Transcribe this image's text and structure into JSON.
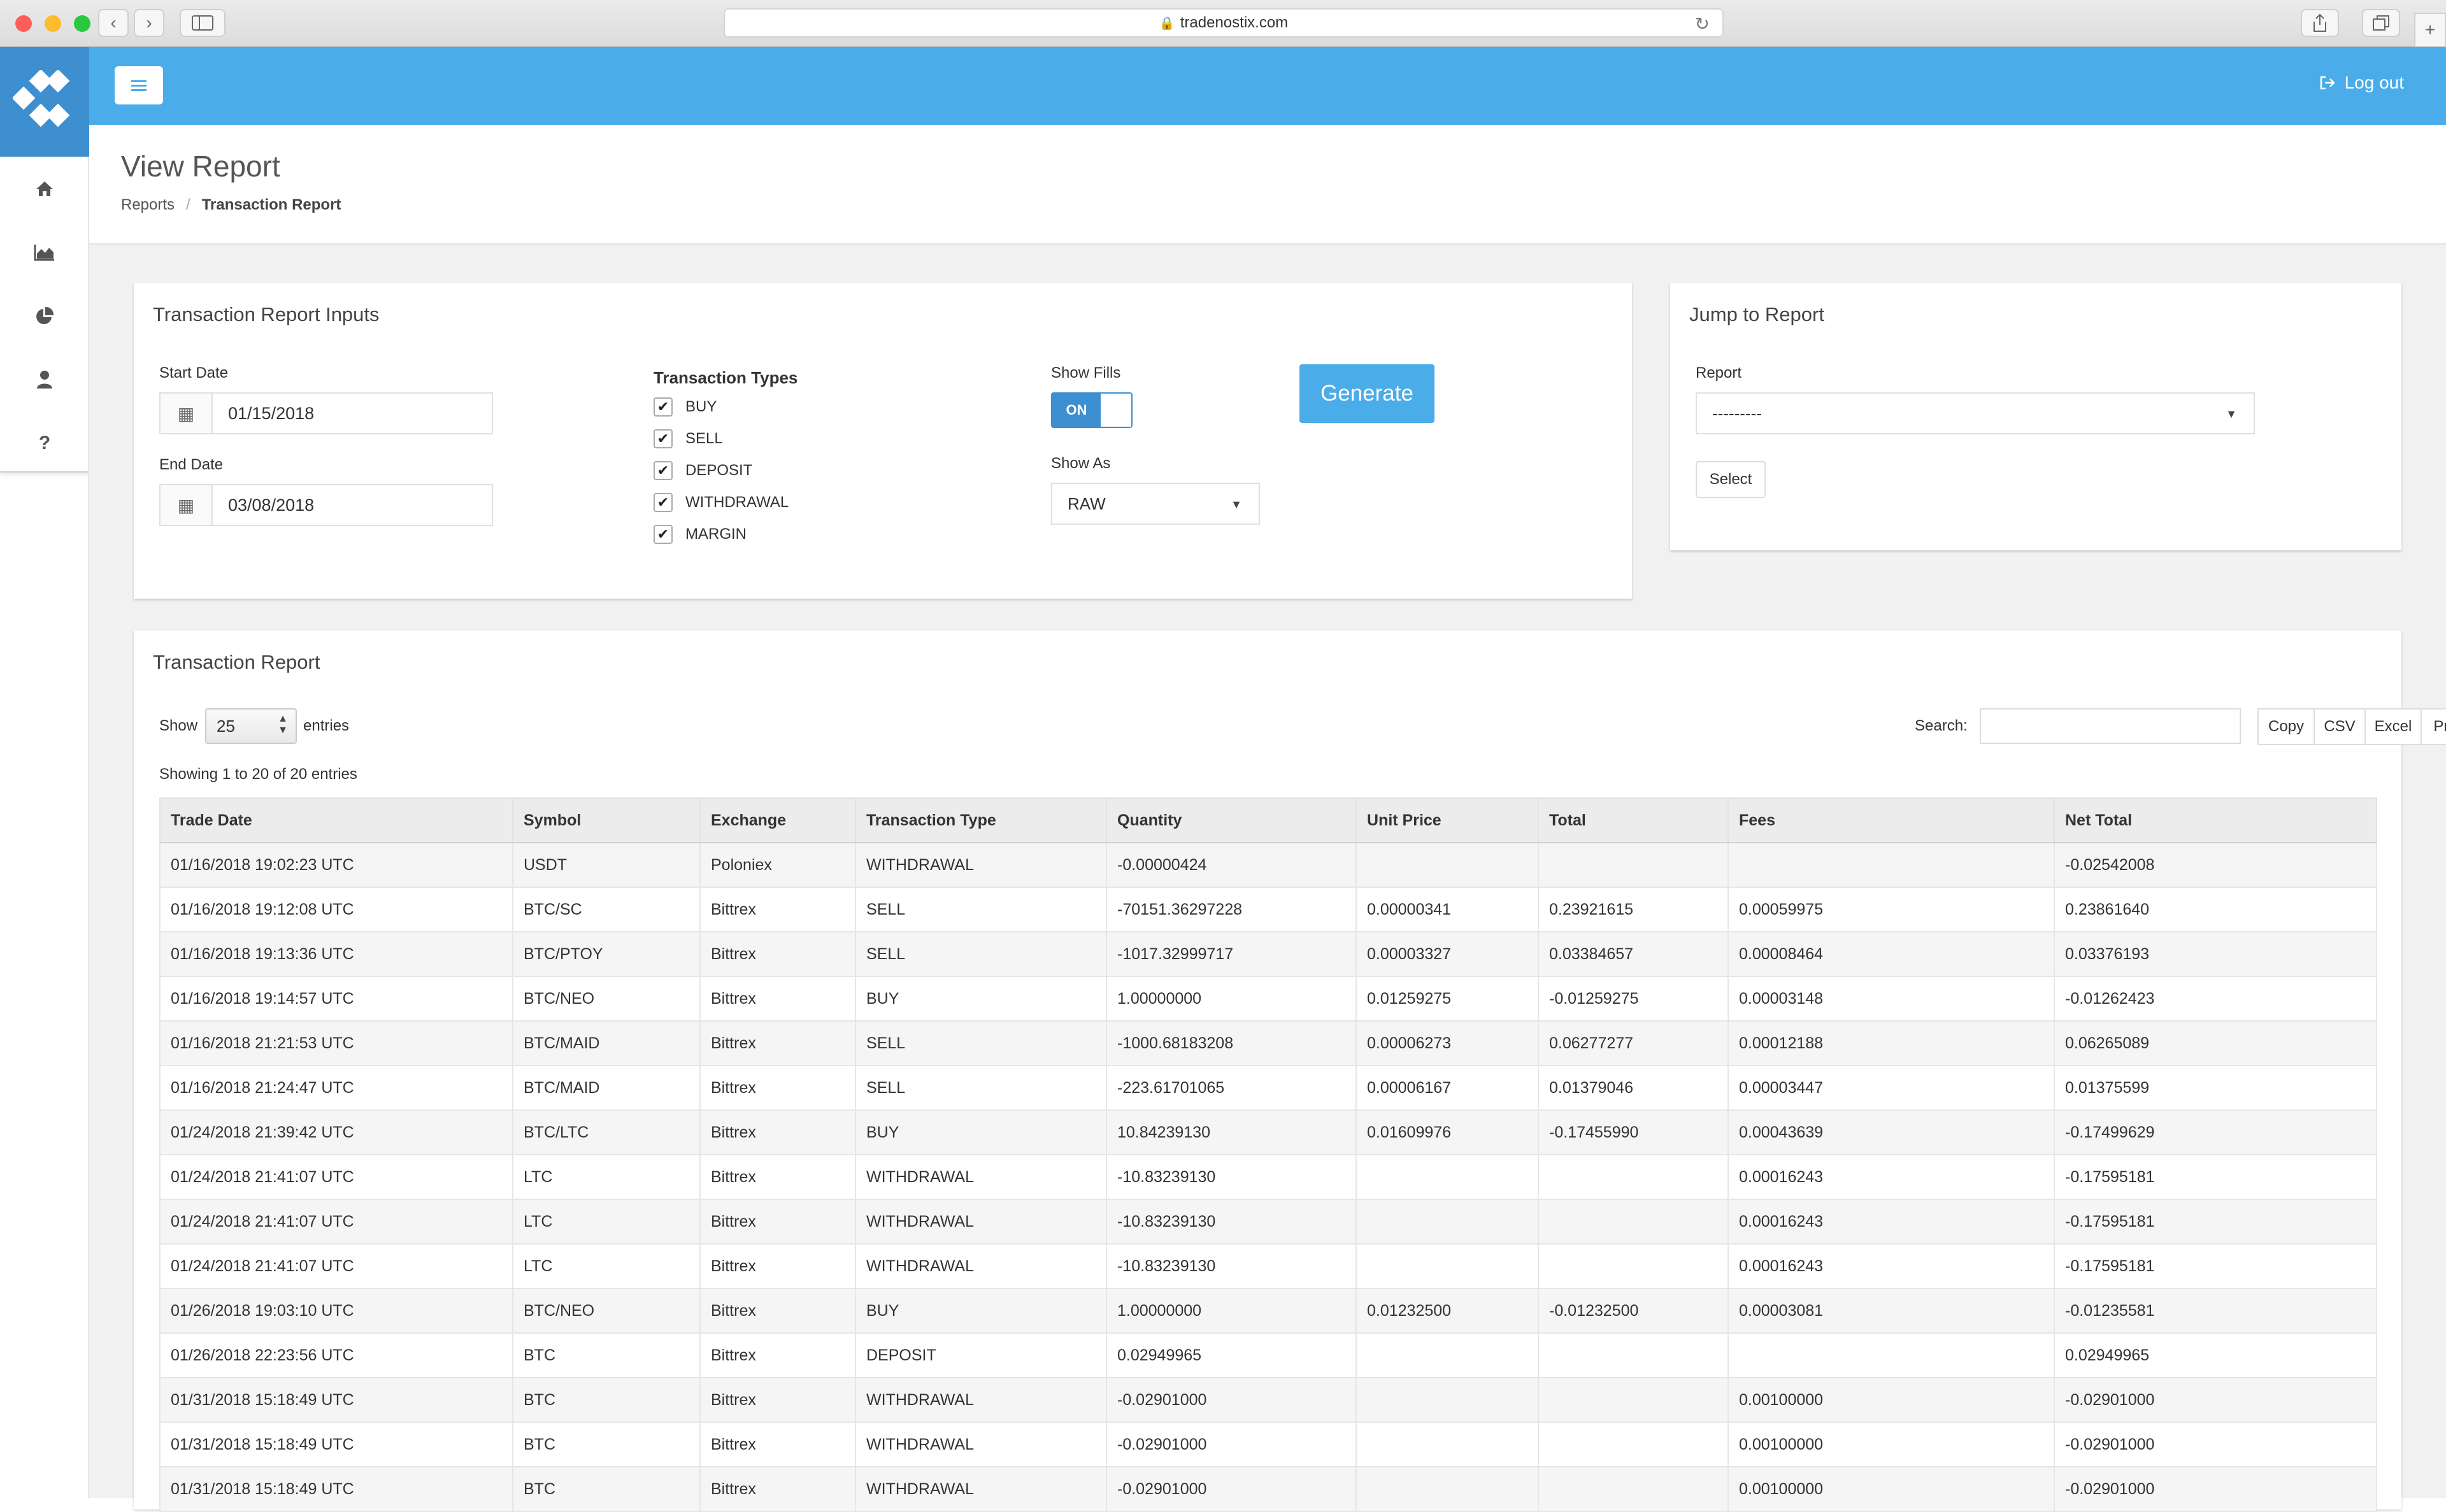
{
  "browser": {
    "url": "tradenostix.com"
  },
  "header": {
    "logout_label": "Log out"
  },
  "page": {
    "title": "View Report",
    "breadcrumb": [
      "Reports",
      "Transaction Report"
    ]
  },
  "inputs": {
    "title": "Transaction Report Inputs",
    "start_date_label": "Start Date",
    "start_date": "01/15/2018",
    "end_date_label": "End Date",
    "end_date": "03/08/2018",
    "types_title": "Transaction Types",
    "types": [
      {
        "label": "BUY",
        "checked": true
      },
      {
        "label": "SELL",
        "checked": true
      },
      {
        "label": "DEPOSIT",
        "checked": true
      },
      {
        "label": "WITHDRAWAL",
        "checked": true
      },
      {
        "label": "MARGIN",
        "checked": true
      }
    ],
    "show_fills_label": "Show Fills",
    "show_fills_state": "ON",
    "show_as_label": "Show As",
    "show_as_value": "RAW",
    "generate_label": "Generate"
  },
  "jump": {
    "title": "Jump to Report",
    "report_label": "Report",
    "report_value": "---------",
    "select_label": "Select"
  },
  "table_panel": {
    "title": "Transaction Report",
    "show_label": "Show",
    "length_value": "25",
    "entries_label": "entries",
    "info": "Showing 1 to 20 of 20 entries",
    "search_label": "Search:",
    "search_value": "",
    "export_buttons": [
      "Copy",
      "CSV",
      "Excel",
      "Print"
    ],
    "columns": [
      "Trade Date",
      "Symbol",
      "Exchange",
      "Transaction Type",
      "Quantity",
      "Unit Price",
      "Total",
      "Fees",
      "Net Total"
    ],
    "rows": [
      [
        "01/16/2018 19:02:23 UTC",
        "USDT",
        "Poloniex",
        "WITHDRAWAL",
        "-0.00000424",
        "",
        "",
        "",
        "-0.02542008"
      ],
      [
        "01/16/2018 19:12:08 UTC",
        "BTC/SC",
        "Bittrex",
        "SELL",
        "-70151.36297228",
        "0.00000341",
        "0.23921615",
        "0.00059975",
        "0.23861640"
      ],
      [
        "01/16/2018 19:13:36 UTC",
        "BTC/PTOY",
        "Bittrex",
        "SELL",
        "-1017.32999717",
        "0.00003327",
        "0.03384657",
        "0.00008464",
        "0.03376193"
      ],
      [
        "01/16/2018 19:14:57 UTC",
        "BTC/NEO",
        "Bittrex",
        "BUY",
        "1.00000000",
        "0.01259275",
        "-0.01259275",
        "0.00003148",
        "-0.01262423"
      ],
      [
        "01/16/2018 21:21:53 UTC",
        "BTC/MAID",
        "Bittrex",
        "SELL",
        "-1000.68183208",
        "0.00006273",
        "0.06277277",
        "0.00012188",
        "0.06265089"
      ],
      [
        "01/16/2018 21:24:47 UTC",
        "BTC/MAID",
        "Bittrex",
        "SELL",
        "-223.61701065",
        "0.00006167",
        "0.01379046",
        "0.00003447",
        "0.01375599"
      ],
      [
        "01/24/2018 21:39:42 UTC",
        "BTC/LTC",
        "Bittrex",
        "BUY",
        "10.84239130",
        "0.01609976",
        "-0.17455990",
        "0.00043639",
        "-0.17499629"
      ],
      [
        "01/24/2018 21:41:07 UTC",
        "LTC",
        "Bittrex",
        "WITHDRAWAL",
        "-10.83239130",
        "",
        "",
        "0.00016243",
        "-0.17595181"
      ],
      [
        "01/24/2018 21:41:07 UTC",
        "LTC",
        "Bittrex",
        "WITHDRAWAL",
        "-10.83239130",
        "",
        "",
        "0.00016243",
        "-0.17595181"
      ],
      [
        "01/24/2018 21:41:07 UTC",
        "LTC",
        "Bittrex",
        "WITHDRAWAL",
        "-10.83239130",
        "",
        "",
        "0.00016243",
        "-0.17595181"
      ],
      [
        "01/26/2018 19:03:10 UTC",
        "BTC/NEO",
        "Bittrex",
        "BUY",
        "1.00000000",
        "0.01232500",
        "-0.01232500",
        "0.00003081",
        "-0.01235581"
      ],
      [
        "01/26/2018 22:23:56 UTC",
        "BTC",
        "Bittrex",
        "DEPOSIT",
        "0.02949965",
        "",
        "",
        "",
        "0.02949965"
      ],
      [
        "01/31/2018 15:18:49 UTC",
        "BTC",
        "Bittrex",
        "WITHDRAWAL",
        "-0.02901000",
        "",
        "",
        "0.00100000",
        "-0.02901000"
      ],
      [
        "01/31/2018 15:18:49 UTC",
        "BTC",
        "Bittrex",
        "WITHDRAWAL",
        "-0.02901000",
        "",
        "",
        "0.00100000",
        "-0.02901000"
      ],
      [
        "01/31/2018 15:18:49 UTC",
        "BTC",
        "Bittrex",
        "WITHDRAWAL",
        "-0.02901000",
        "",
        "",
        "0.00100000",
        "-0.02901000"
      ]
    ]
  },
  "colors": {
    "header_blue": "#4aace8",
    "logo_blue": "#3d8fd0",
    "page_bg": "#f1f1f1"
  },
  "icons": {
    "sidebar": [
      "home-icon",
      "area-chart-icon",
      "pie-chart-icon",
      "user-icon",
      "question-icon"
    ],
    "logout": "sign-out-icon",
    "menu": "hamburger-menu-icon",
    "calendar": "calendar-icon"
  }
}
